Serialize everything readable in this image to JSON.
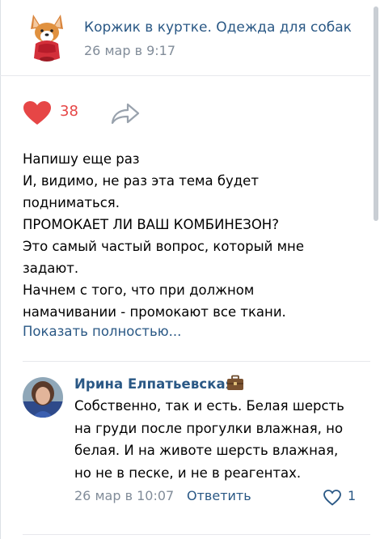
{
  "post": {
    "group_name": "Коржик в куртке. Одежда для собак",
    "date": "26 мар в 9:17",
    "likes": "38",
    "lines": [
      "Напишу еще раз",
      "И, видимо, не раз эта тема будет",
      "подниматься.",
      "ПРОМОКАЕТ ЛИ ВАШ КОМБИНЕЗОН?",
      "Это самый частый вопрос, который мне",
      "задают.",
      "Начнем с того, что при должном",
      "намачивании - промокают все ткани."
    ],
    "show_more": "Показать полностью..."
  },
  "comment": {
    "author": "Ирина Елпатьевская",
    "lines": [
      "Собственно, так и есть. Белая шерсть",
      "на груди после прогулки влажная, но",
      "белая. И на животе шерсть влажная,",
      "но не в песке, и не в реагентах."
    ],
    "date": "26 мар в 10:07",
    "reply": "Ответить",
    "likes": "1"
  },
  "icons": {
    "like": "heart-icon",
    "share": "share-arrow-icon",
    "badge": "briefcase-icon",
    "comment_like": "heart-outline-icon"
  },
  "colors": {
    "link": "#2a5885",
    "like_red": "#e64646",
    "meta_gray": "#818c99"
  }
}
